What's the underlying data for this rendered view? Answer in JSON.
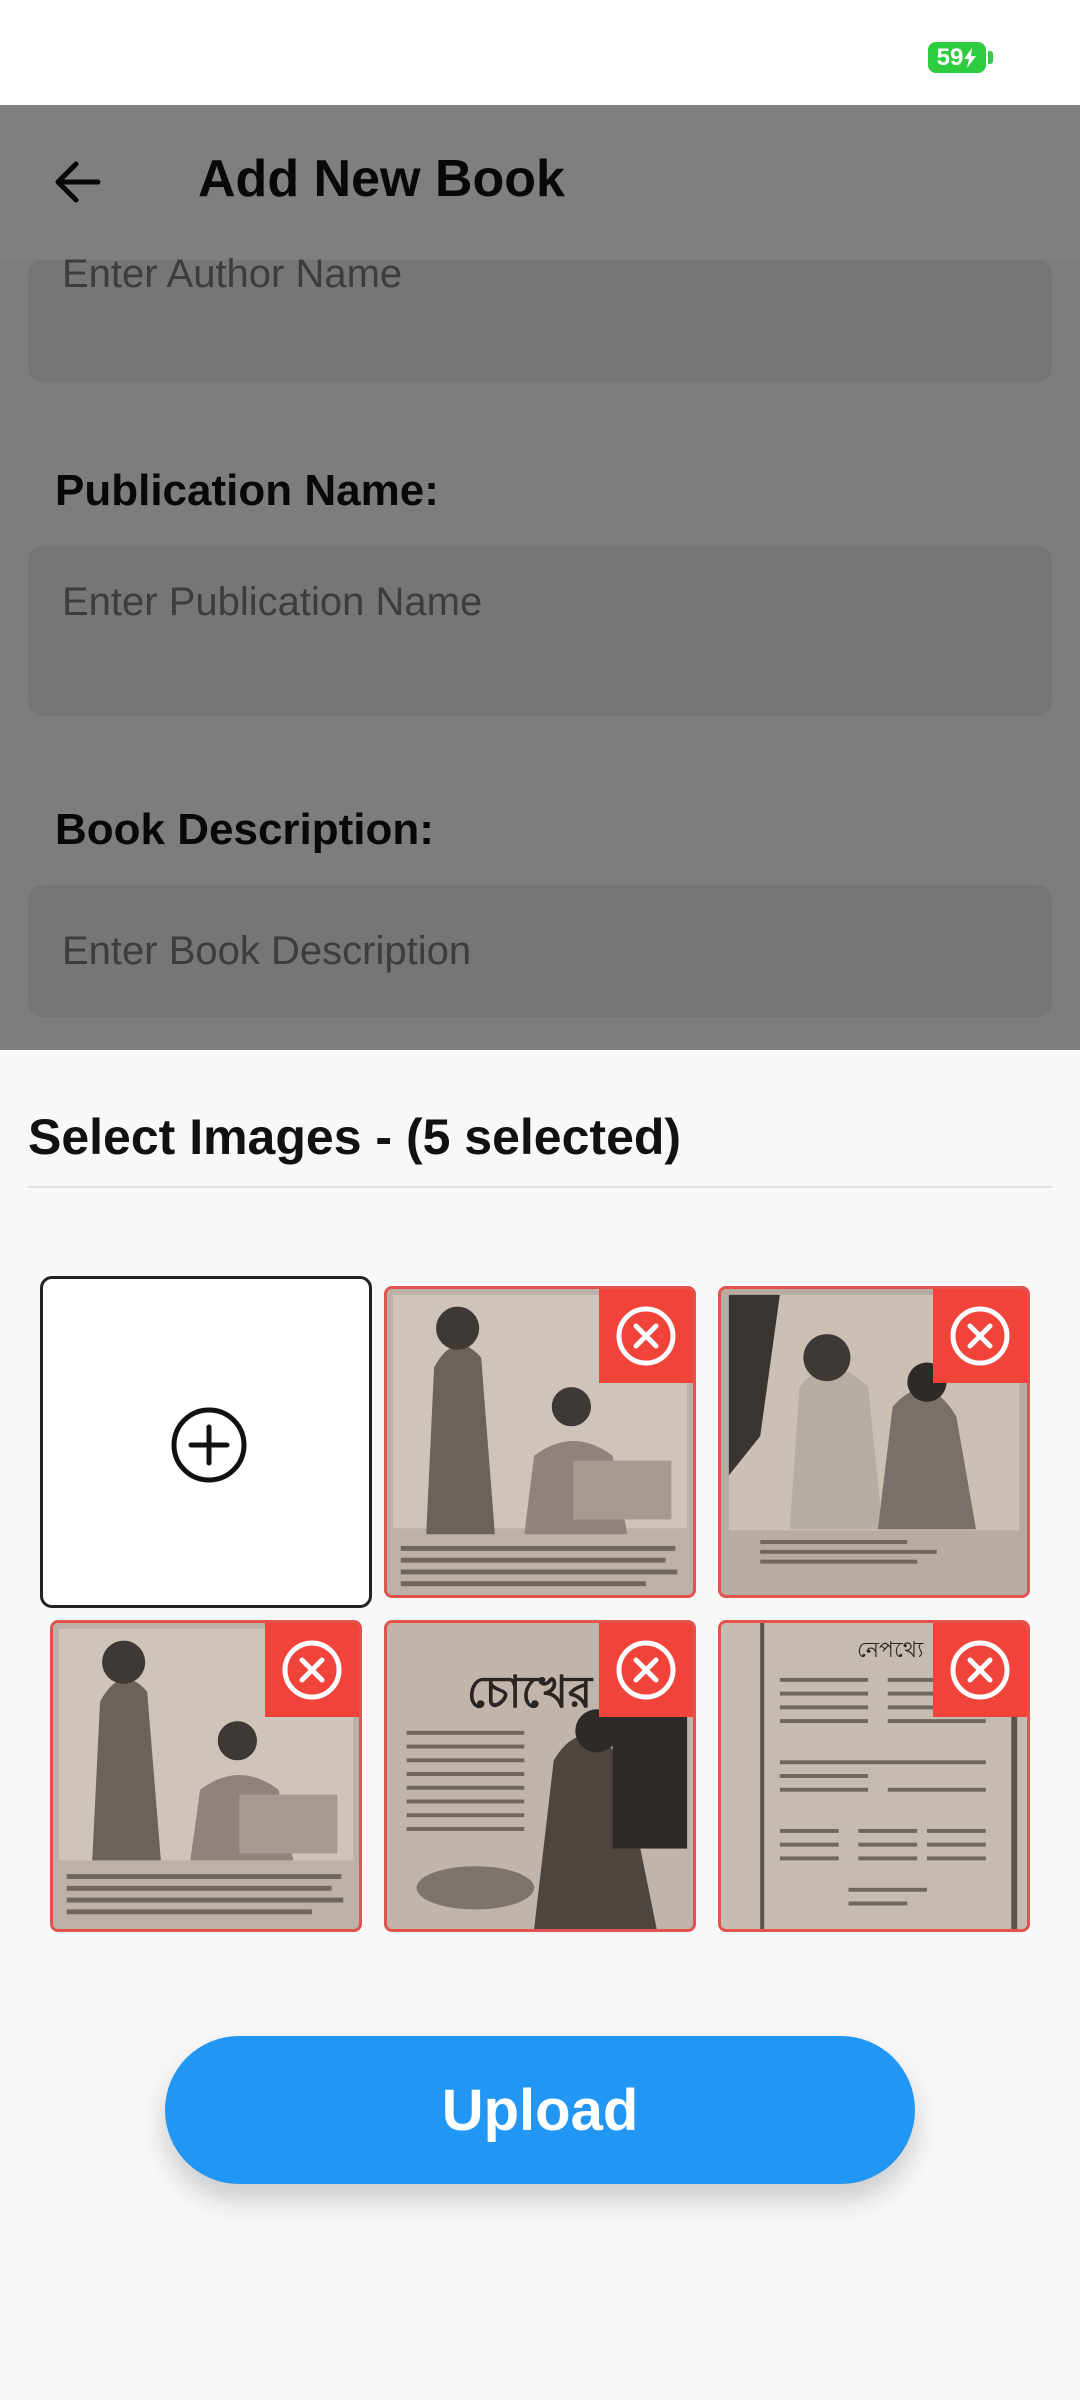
{
  "status": {
    "battery": "59"
  },
  "header": {
    "title": "Add New Book"
  },
  "form": {
    "author_placeholder": "Enter Author Name",
    "publication_label": "Publication Name:",
    "publication_placeholder": "Enter Publication Name",
    "description_label": "Book Description:",
    "description_placeholder": "Enter Book Description"
  },
  "sheet": {
    "title": "Select Images - (5 selected)",
    "selected_count": 5,
    "upload_label": "Upload"
  },
  "images": [
    {
      "caption": ""
    },
    {
      "caption": ""
    },
    {
      "caption": ""
    },
    {
      "caption": "চোখের বালি"
    },
    {
      "caption": "নেপথ্যে"
    }
  ],
  "colors": {
    "accent": "#2196f3",
    "remove": "#f0433a",
    "battery": "#2ecc40"
  }
}
